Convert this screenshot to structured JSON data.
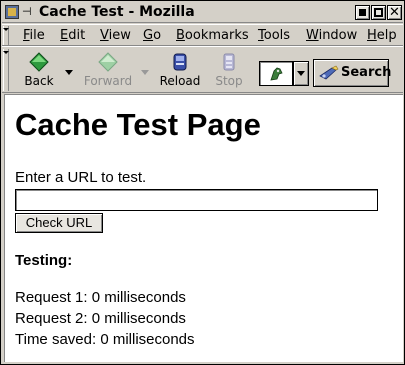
{
  "window": {
    "title": "Cache Test - Mozilla",
    "pin_glyph": "⊣"
  },
  "menubar": {
    "items": [
      {
        "first": "F",
        "rest": "ile"
      },
      {
        "first": "E",
        "rest": "dit"
      },
      {
        "first": "V",
        "rest": "iew"
      },
      {
        "first": "G",
        "rest": "o"
      },
      {
        "first": "B",
        "rest": "ookmarks"
      },
      {
        "first": "T",
        "rest": "ools"
      },
      {
        "first": "W",
        "rest": "indow"
      },
      {
        "first": "H",
        "rest": "elp"
      }
    ]
  },
  "toolbar": {
    "back": "Back",
    "forward": "Forward",
    "reload": "Reload",
    "stop": "Stop",
    "search": "Search"
  },
  "icons": {
    "back": "back-arrow-icon",
    "forward": "forward-arrow-icon",
    "reload": "reload-icon",
    "stop": "stop-icon",
    "throbber": "mozilla-throbber-icon",
    "search": "search-icon"
  },
  "page": {
    "heading": "Cache Test Page",
    "prompt": "Enter a URL to test.",
    "url_value": "",
    "check_button": "Check URL",
    "testing_label": "Testing:",
    "results": [
      {
        "label": "Request 1:",
        "value": "0 milliseconds"
      },
      {
        "label": "Request 2:",
        "value": "0 milliseconds"
      },
      {
        "label": "Time saved:",
        "value": "0 milliseconds"
      }
    ]
  },
  "colors": {
    "chrome": "#d4d0c8",
    "content": "#ffffff",
    "back_green": "#2e9a3e",
    "reload_blue": "#3a4fa8"
  }
}
